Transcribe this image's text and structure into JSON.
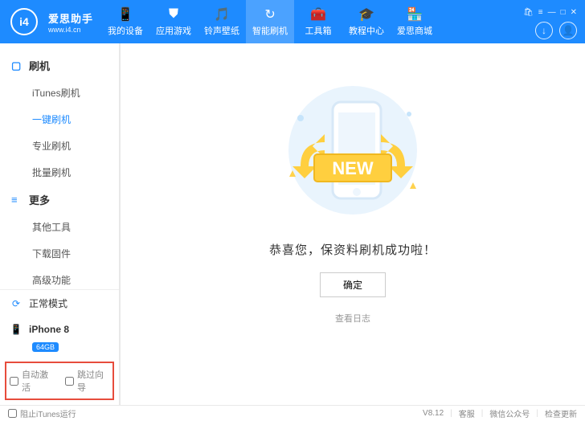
{
  "app": {
    "name": "爱思助手",
    "url": "www.i4.cn"
  },
  "tabs": [
    {
      "icon": "📱",
      "label": "我的设备"
    },
    {
      "icon": "⛊",
      "label": "应用游戏"
    },
    {
      "icon": "🎵",
      "label": "铃声壁纸"
    },
    {
      "icon": "↻",
      "label": "智能刷机"
    },
    {
      "icon": "🧰",
      "label": "工具箱"
    },
    {
      "icon": "🎓",
      "label": "教程中心"
    },
    {
      "icon": "🏪",
      "label": "爱思商城"
    }
  ],
  "sidebar": {
    "sections": [
      {
        "title": "刷机",
        "items": [
          "iTunes刷机",
          "一键刷机",
          "专业刷机",
          "批量刷机"
        ],
        "activeIndex": 1
      },
      {
        "title": "更多",
        "items": [
          "其他工具",
          "下载固件",
          "高级功能"
        ],
        "activeIndex": -1
      }
    ],
    "mode": "正常模式",
    "device": {
      "name": "iPhone 8",
      "badge": "64GB"
    },
    "checks": {
      "autoActivate": "自动激活",
      "skipGuide": "跳过向导"
    }
  },
  "main": {
    "banner": "NEW",
    "message": "恭喜您，保资料刷机成功啦！",
    "ok": "确定",
    "viewLog": "查看日志"
  },
  "footer": {
    "block": "阻止iTunes运行",
    "version": "V8.12",
    "service": "客服",
    "wechat": "微信公众号",
    "update": "检查更新"
  }
}
